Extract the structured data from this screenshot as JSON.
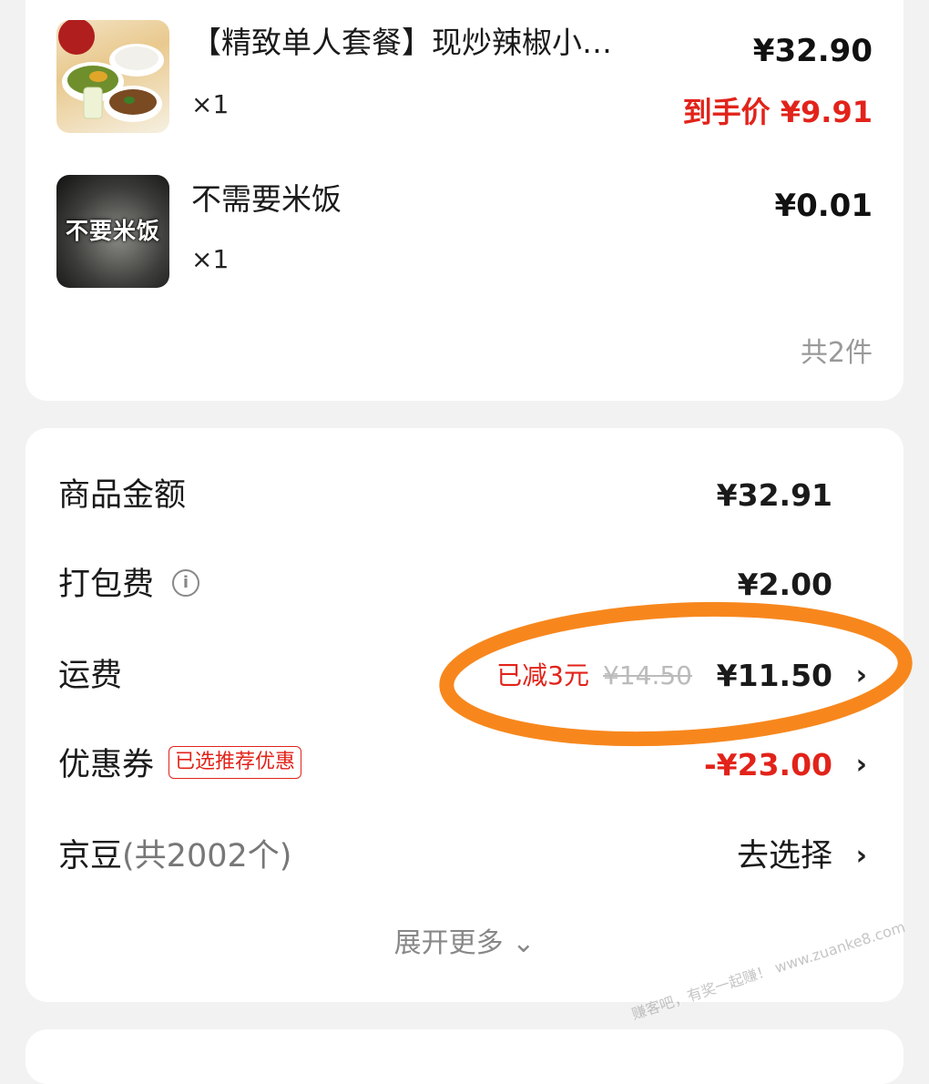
{
  "items": [
    {
      "name": "【精致单人套餐】现炒辣椒小…",
      "quantity": "×1",
      "price": "¥32.90",
      "final_price": "到手价 ¥9.91"
    },
    {
      "name": "不需要米饭",
      "quantity": "×1",
      "price": "¥0.01",
      "thumb_caption": "不要米饭"
    }
  ],
  "total_count": "共2件",
  "summary": {
    "goods_amount": {
      "label": "商品金额",
      "value": "¥32.91"
    },
    "packing_fee": {
      "label": "打包费",
      "value": "¥2.00",
      "info_icon": "i"
    },
    "delivery_fee": {
      "label": "运费",
      "discount_note": "已减3元",
      "original": "¥14.50",
      "value": "¥11.50"
    },
    "coupon": {
      "label": "优惠券",
      "tag": "已选推荐优惠",
      "value": "-¥23.00"
    },
    "jd_beans": {
      "label": "京豆",
      "count": "(共2002个)",
      "action": "去选择"
    },
    "expand": "展开更多 ⌄"
  },
  "icons": {
    "chevron": "›",
    "info": "info-circle-icon"
  },
  "colors": {
    "accent_red": "#e2231a",
    "highlight_orange": "#f7871d",
    "muted_gray": "#999999"
  },
  "watermark": "赚客吧，有奖一起赚！ www.zuanke8.com"
}
